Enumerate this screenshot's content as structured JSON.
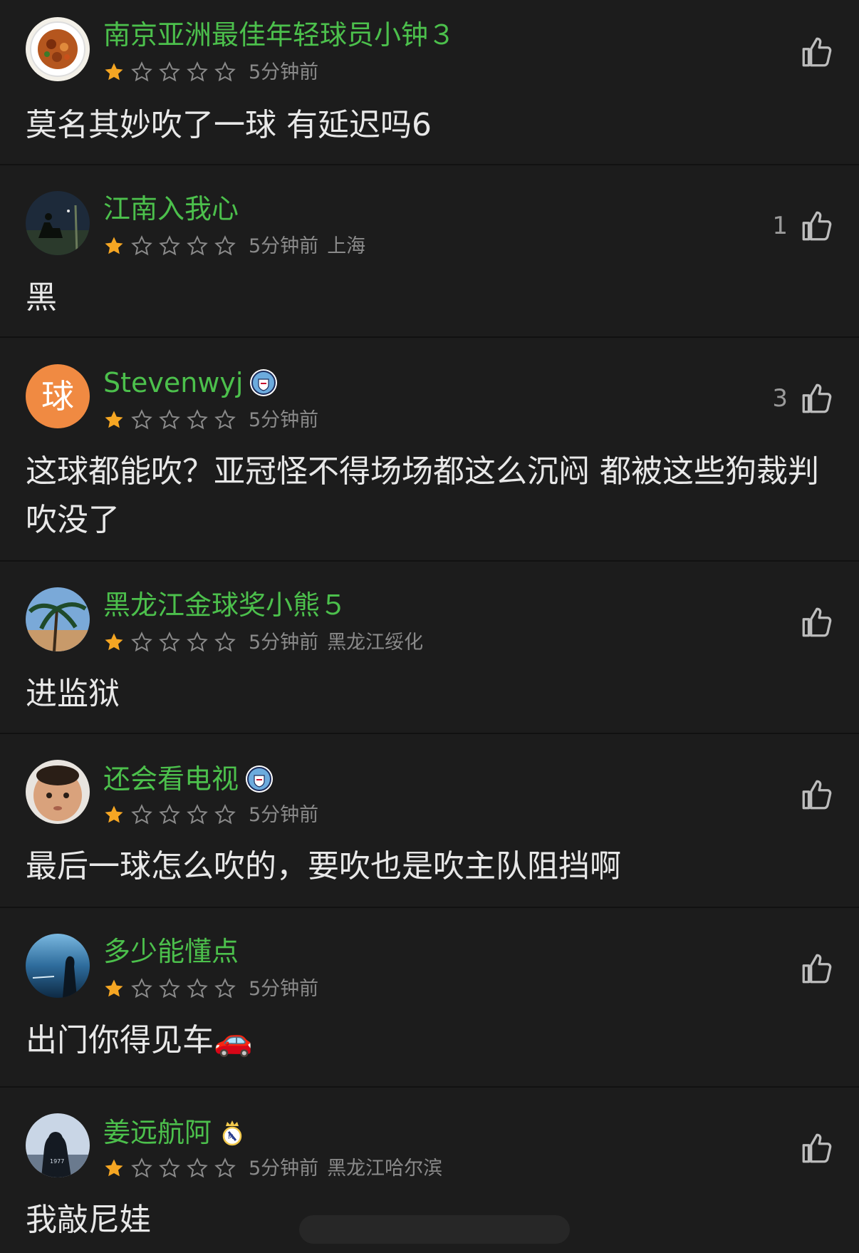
{
  "comments": [
    {
      "name": "南京亚洲最佳年轻球员小钟３",
      "time": "5分钟前",
      "location": "",
      "likes": "",
      "text": "莫名其妙吹了一球 有延迟吗6",
      "rating": 1,
      "badge": ""
    },
    {
      "name": "江南入我心",
      "time": "5分钟前",
      "location": "上海",
      "likes": "1",
      "text": "黑",
      "rating": 1,
      "badge": ""
    },
    {
      "name": "Stevenwyj",
      "time": "5分钟前",
      "location": "",
      "likes": "3",
      "text": "这球都能吹？亚冠怪不得场场都这么沉闷 都被这些狗裁判吹没了",
      "rating": 1,
      "badge": "man-city-badge-icon",
      "avatar_text": "球"
    },
    {
      "name": "黑龙江金球奖小熊５",
      "time": "5分钟前",
      "location": "黑龙江绥化",
      "likes": "",
      "text": "进监狱",
      "rating": 1,
      "badge": ""
    },
    {
      "name": "还会看电视",
      "time": "5分钟前",
      "location": "",
      "likes": "",
      "text": "最后一球怎么吹的，要吹也是吹主队阻挡啊",
      "rating": 1,
      "badge": "man-city-badge-icon"
    },
    {
      "name": "多少能懂点",
      "time": "5分钟前",
      "location": "",
      "likes": "",
      "text": "出门你得见车🚗",
      "rating": 1,
      "badge": ""
    },
    {
      "name": "姜远航阿",
      "time": "5分钟前",
      "location": "黑龙江哈尔滨",
      "likes": "",
      "text": "我敲尼娃",
      "rating": 1,
      "badge": "real-madrid-badge-icon"
    }
  ],
  "colors": {
    "name": "#4cc04c",
    "star_filled": "#f5a623",
    "background": "#1c1c1c"
  }
}
